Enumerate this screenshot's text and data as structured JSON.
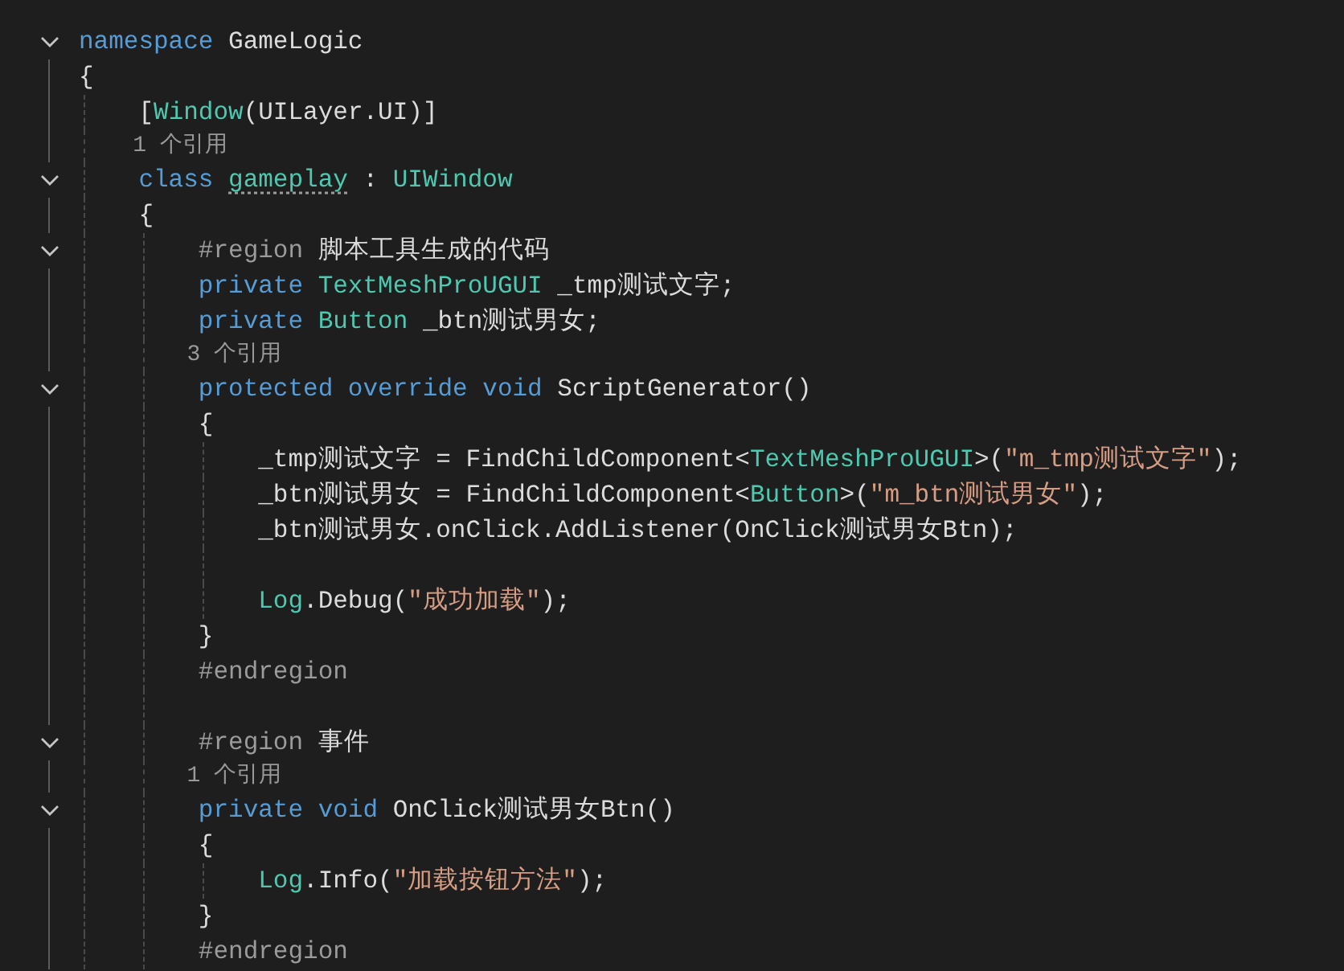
{
  "editor": {
    "lines": [
      {
        "kind": "fold",
        "expanded": true,
        "tokens": [
          {
            "kind": "keyword",
            "text": "namespace"
          },
          {
            "kind": "plain",
            "text": " GameLogic"
          }
        ]
      },
      {
        "kind": "code",
        "tokens": [
          {
            "kind": "plain",
            "text": "{"
          }
        ]
      },
      {
        "kind": "code",
        "tokens": [
          {
            "kind": "plain",
            "text": "    ["
          },
          {
            "kind": "type",
            "text": "Window"
          },
          {
            "kind": "plain",
            "text": "(UILayer.UI)]"
          }
        ]
      },
      {
        "kind": "codelens",
        "text": "    1 个引用"
      },
      {
        "kind": "fold",
        "expanded": true,
        "tokens": [
          {
            "kind": "keyword",
            "text": "    class "
          },
          {
            "kind": "type",
            "text": "gameplay",
            "suggestion": true
          },
          {
            "kind": "plain",
            "text": " : "
          },
          {
            "kind": "type",
            "text": "UIWindow"
          }
        ]
      },
      {
        "kind": "code",
        "tokens": [
          {
            "kind": "plain",
            "text": "    {"
          }
        ]
      },
      {
        "kind": "fold",
        "expanded": true,
        "tokens": [
          {
            "kind": "preprocessor",
            "text": "        #region"
          },
          {
            "kind": "plain",
            "text": " 脚本工具生成的代码"
          }
        ]
      },
      {
        "kind": "code",
        "tokens": [
          {
            "kind": "keyword",
            "text": "        private "
          },
          {
            "kind": "type",
            "text": "TextMeshProUGUI"
          },
          {
            "kind": "plain",
            "text": " _tmp测试文字;"
          }
        ]
      },
      {
        "kind": "code",
        "tokens": [
          {
            "kind": "keyword",
            "text": "        private "
          },
          {
            "kind": "type",
            "text": "Button"
          },
          {
            "kind": "plain",
            "text": " _btn测试男女;"
          }
        ]
      },
      {
        "kind": "codelens",
        "text": "        3 个引用"
      },
      {
        "kind": "fold",
        "expanded": true,
        "tokens": [
          {
            "kind": "keyword",
            "text": "        protected override void"
          },
          {
            "kind": "plain",
            "text": " ScriptGenerator()"
          }
        ]
      },
      {
        "kind": "code",
        "tokens": [
          {
            "kind": "plain",
            "text": "        {"
          }
        ]
      },
      {
        "kind": "code",
        "tokens": [
          {
            "kind": "plain",
            "text": "            _tmp测试文字 = FindChildComponent<"
          },
          {
            "kind": "type",
            "text": "TextMeshProUGUI"
          },
          {
            "kind": "plain",
            "text": ">("
          },
          {
            "kind": "string",
            "text": "\"m_tmp测试文字\""
          },
          {
            "kind": "plain",
            "text": ");"
          }
        ]
      },
      {
        "kind": "code",
        "tokens": [
          {
            "kind": "plain",
            "text": "            _btn测试男女 = FindChildComponent<"
          },
          {
            "kind": "type",
            "text": "Button"
          },
          {
            "kind": "plain",
            "text": ">("
          },
          {
            "kind": "string",
            "text": "\"m_btn测试男女\""
          },
          {
            "kind": "plain",
            "text": ");"
          }
        ]
      },
      {
        "kind": "code",
        "tokens": [
          {
            "kind": "plain",
            "text": "            _btn测试男女.onClick.AddListener(OnClick测试男女Btn);"
          }
        ]
      },
      {
        "kind": "blank"
      },
      {
        "kind": "code",
        "tokens": [
          {
            "kind": "type",
            "text": "            Log"
          },
          {
            "kind": "plain",
            "text": ".Debug("
          },
          {
            "kind": "string",
            "text": "\"成功加载\""
          },
          {
            "kind": "plain",
            "text": ");"
          }
        ]
      },
      {
        "kind": "code",
        "tokens": [
          {
            "kind": "plain",
            "text": "        }"
          }
        ]
      },
      {
        "kind": "code",
        "tokens": [
          {
            "kind": "preprocessor",
            "text": "        #endregion"
          }
        ]
      },
      {
        "kind": "blank"
      },
      {
        "kind": "fold",
        "expanded": true,
        "tokens": [
          {
            "kind": "preprocessor",
            "text": "        #region"
          },
          {
            "kind": "plain",
            "text": " 事件"
          }
        ]
      },
      {
        "kind": "codelens",
        "text": "        1 个引用"
      },
      {
        "kind": "fold",
        "expanded": true,
        "tokens": [
          {
            "kind": "keyword",
            "text": "        private void"
          },
          {
            "kind": "plain",
            "text": " OnClick测试男女Btn()"
          }
        ]
      },
      {
        "kind": "code",
        "tokens": [
          {
            "kind": "plain",
            "text": "        {"
          }
        ]
      },
      {
        "kind": "code",
        "tokens": [
          {
            "kind": "type",
            "text": "            Log"
          },
          {
            "kind": "plain",
            "text": ".Info("
          },
          {
            "kind": "string",
            "text": "\"加载按钮方法\""
          },
          {
            "kind": "plain",
            "text": ");"
          }
        ]
      },
      {
        "kind": "code",
        "tokens": [
          {
            "kind": "plain",
            "text": "        }"
          }
        ]
      },
      {
        "kind": "code",
        "tokens": [
          {
            "kind": "preprocessor",
            "text": "        #endregion"
          }
        ]
      }
    ]
  }
}
